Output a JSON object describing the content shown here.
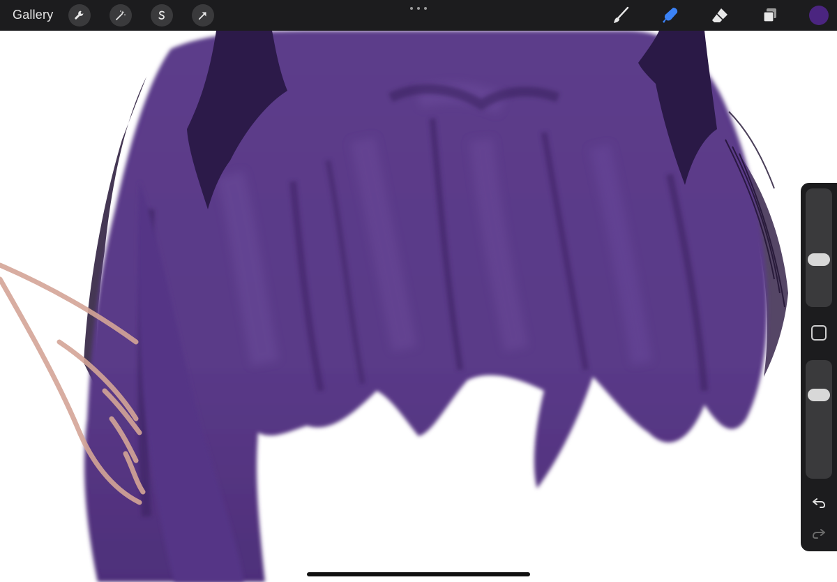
{
  "toolbar": {
    "gallery_label": "Gallery",
    "left_tools": [
      {
        "name": "actions",
        "icon": "wrench-icon"
      },
      {
        "name": "adjustments",
        "icon": "magic-wand-icon"
      },
      {
        "name": "selection",
        "icon": "selection-s-icon"
      },
      {
        "name": "transform",
        "icon": "arrow-cursor-icon"
      }
    ],
    "more_icon": "more-dots-icon",
    "right_tools": [
      {
        "name": "brush",
        "icon": "brush-icon",
        "active": false
      },
      {
        "name": "smudge",
        "icon": "smudge-icon",
        "active": true
      },
      {
        "name": "eraser",
        "icon": "eraser-icon",
        "active": false
      },
      {
        "name": "layers",
        "icon": "layers-icon",
        "active": false
      }
    ],
    "current_color": "#4b2580"
  },
  "sidebar": {
    "brush_size_level": 0.38,
    "opacity_level": 0.75,
    "modifier_icon": "square-modifier-icon",
    "undo_icon": "undo-icon",
    "redo_icon": "redo-icon"
  },
  "colors": {
    "accent_active": "#3b82f6",
    "hair_base": "#5a3a87",
    "hair_dark": "#2d1a4a",
    "sketch_line": "#d4a597",
    "ui_bar": "#1c1c1e"
  }
}
